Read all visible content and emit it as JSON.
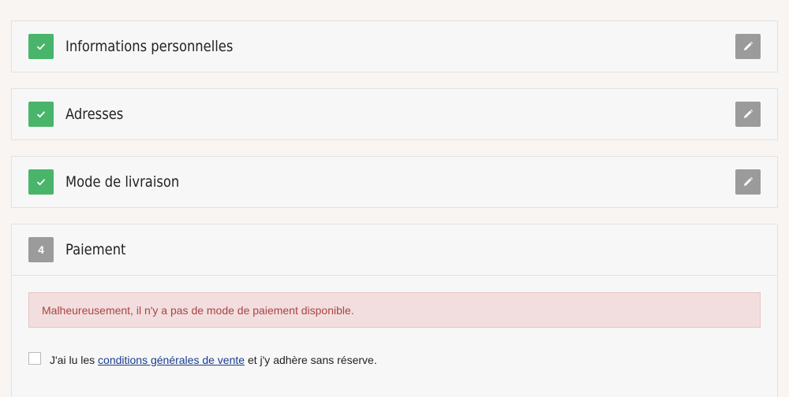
{
  "steps": [
    {
      "title": "Informations personnelles",
      "status": "done",
      "icon": "check-icon",
      "edit_icon": "pencil-icon"
    },
    {
      "title": "Adresses",
      "status": "done",
      "icon": "check-icon",
      "edit_icon": "pencil-icon"
    },
    {
      "title": "Mode de livraison",
      "status": "done",
      "icon": "check-icon",
      "edit_icon": "pencil-icon"
    },
    {
      "title": "Paiement",
      "status": "current",
      "number": "4"
    }
  ],
  "payment": {
    "alert_text": "Malheureusement, il n'y a pas de mode de paiement disponible.",
    "terms_prefix": "J'ai lu les ",
    "terms_link": "conditions générales de vente",
    "terms_suffix": " et j'y adhère sans réserve."
  },
  "colors": {
    "done_badge": "#48b56a",
    "number_badge": "#9b9b9b",
    "edit_button": "#9b9b9b",
    "alert_bg": "#f2dede",
    "alert_text": "#a94442",
    "link": "#1a3d8f"
  }
}
